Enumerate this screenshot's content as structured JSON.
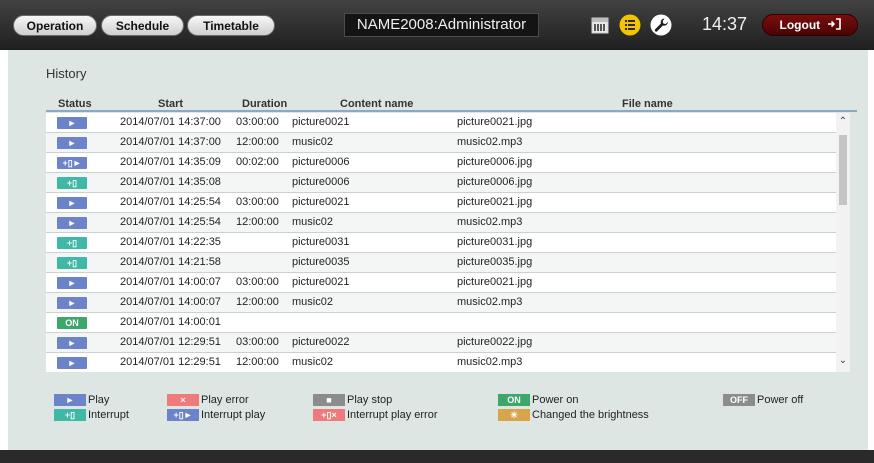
{
  "nav": {
    "operation": "Operation",
    "schedule": "Schedule",
    "timetable": "Timetable"
  },
  "header": {
    "title": "NAME2008:Administrator",
    "clock": "14:37",
    "logout": "Logout",
    "icons": [
      "calendar-icon",
      "list-icon",
      "wrench-icon",
      "logout-icon"
    ]
  },
  "history": {
    "title": "History",
    "columns": {
      "status": "Status",
      "start": "Start",
      "duration": "Duration",
      "content": "Content name",
      "file": "File name"
    },
    "rows": [
      {
        "status": "play",
        "badge": "►",
        "start": "2014/07/01 14:37:00",
        "duration": "03:00:00",
        "content": "picture0021",
        "file": "picture0021.jpg"
      },
      {
        "status": "play",
        "badge": "►",
        "start": "2014/07/01 14:37:00",
        "duration": "12:00:00",
        "content": "music02",
        "file": "music02.mp3"
      },
      {
        "status": "interrupt-play",
        "badge": "+▯►",
        "start": "2014/07/01 14:35:09",
        "duration": "00:02:00",
        "content": "picture0006",
        "file": "picture0006.jpg"
      },
      {
        "status": "interrupt",
        "badge": "+▯",
        "start": "2014/07/01 14:35:08",
        "duration": "",
        "content": "picture0006",
        "file": "picture0006.jpg"
      },
      {
        "status": "play",
        "badge": "►",
        "start": "2014/07/01 14:25:54",
        "duration": "03:00:00",
        "content": "picture0021",
        "file": "picture0021.jpg"
      },
      {
        "status": "play",
        "badge": "►",
        "start": "2014/07/01 14:25:54",
        "duration": "12:00:00",
        "content": "music02",
        "file": "music02.mp3"
      },
      {
        "status": "interrupt",
        "badge": "+▯",
        "start": "2014/07/01 14:22:35",
        "duration": "",
        "content": "picture0031",
        "file": "picture0031.jpg"
      },
      {
        "status": "interrupt",
        "badge": "+▯",
        "start": "2014/07/01 14:21:58",
        "duration": "",
        "content": "picture0035",
        "file": "picture0035.jpg"
      },
      {
        "status": "play",
        "badge": "►",
        "start": "2014/07/01 14:00:07",
        "duration": "03:00:00",
        "content": "picture0021",
        "file": "picture0021.jpg"
      },
      {
        "status": "play",
        "badge": "►",
        "start": "2014/07/01 14:00:07",
        "duration": "12:00:00",
        "content": "music02",
        "file": "music02.mp3"
      },
      {
        "status": "power-on",
        "badge": "ON",
        "start": "2014/07/01 14:00:01",
        "duration": "",
        "content": "",
        "file": ""
      },
      {
        "status": "play",
        "badge": "►",
        "start": "2014/07/01 12:29:51",
        "duration": "03:00:00",
        "content": "picture0022",
        "file": "picture0022.jpg"
      },
      {
        "status": "play",
        "badge": "►",
        "start": "2014/07/01 12:29:51",
        "duration": "12:00:00",
        "content": "music02",
        "file": "music02.mp3"
      }
    ]
  },
  "legend": {
    "play": {
      "badge": "►",
      "label": "Play"
    },
    "play_error": {
      "badge": "×",
      "label": "Play error"
    },
    "play_stop": {
      "badge": "■",
      "label": "Play stop"
    },
    "power_on": {
      "badge": "ON",
      "label": "Power on"
    },
    "power_off": {
      "badge": "OFF",
      "label": "Power off"
    },
    "interrupt": {
      "badge": "+▯",
      "label": "Interrupt"
    },
    "interrupt_play": {
      "badge": "+▯►",
      "label": "Interrupt play"
    },
    "interrupt_play_error": {
      "badge": "+▯×",
      "label": "Interrupt play error"
    },
    "brightness": {
      "badge": "☀",
      "label": "Changed the brightness"
    }
  },
  "colors": {
    "play": "#6d83c9",
    "interrupt": "#3fb8a8",
    "power_on": "#3da76b",
    "play_error": "#ef7a7a",
    "play_stop": "#8c8c8c",
    "power_off": "#8c8c8c",
    "brightness": "#d9a54a",
    "logout": "#5b0808",
    "active_icon": "#f5c400"
  }
}
